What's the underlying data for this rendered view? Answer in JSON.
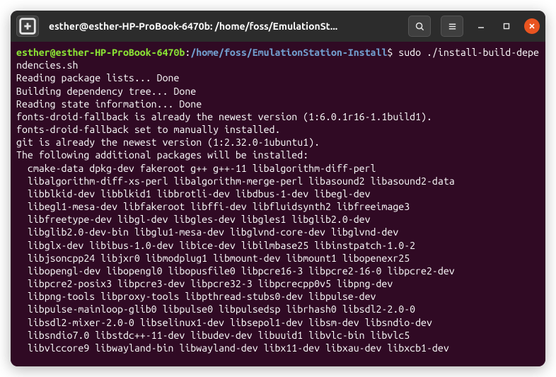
{
  "titlebar": {
    "title": "esther@esther-HP-ProBook-6470b: /home/foss/EmulationSt..."
  },
  "prompt": {
    "user": "esther@esther-HP-ProBook-6470b",
    "colon": ":",
    "path": "/home/foss/EmulationStation-Install",
    "dollar": "$",
    "command": "sudo ./install-build-dependencies.sh"
  },
  "output": {
    "l1": "Reading package lists... Done",
    "l2": "Building dependency tree... Done",
    "l3": "Reading state information... Done",
    "l4": "fonts-droid-fallback is already the newest version (1:6.0.1r16-1.1build1).",
    "l5": "fonts-droid-fallback set to manually installed.",
    "l6": "git is already the newest version (1:2.32.0-1ubuntu1).",
    "l7": "The following additional packages will be installed:",
    "p1": "  cmake-data dpkg-dev fakeroot g++ g++-11 libalgorithm-diff-perl",
    "p2": "  libalgorithm-diff-xs-perl libalgorithm-merge-perl libasound2 libasound2-data",
    "p3": "  libblkid-dev libblkid1 libbrotli-dev libdbus-1-dev libegl-dev",
    "p4": "  libegl1-mesa-dev libfakeroot libffi-dev libfluidsynth2 libfreeimage3",
    "p5": "  libfreetype-dev libgl-dev libgles-dev libgles1 libglib2.0-dev",
    "p6": "  libglib2.0-dev-bin libglu1-mesa-dev libglvnd-core-dev libglvnd-dev",
    "p7": "  libglx-dev libibus-1.0-dev libice-dev libilmbase25 libinstpatch-1.0-2",
    "p8": "  libjsoncpp24 libjxr0 libmodplug1 libmount-dev libmount1 libopenexr25",
    "p9": "  libopengl-dev libopengl0 libopusfile0 libpcre16-3 libpcre2-16-0 libpcre2-dev",
    "p10": "  libpcre2-posix3 libpcre3-dev libpcre32-3 libpcrecpp0v5 libpng-dev",
    "p11": "  libpng-tools libproxy-tools libpthread-stubs0-dev libpulse-dev",
    "p12": "  libpulse-mainloop-glib0 libpulse0 libpulsedsp librhash0 libsdl2-2.0-0",
    "p13": "  libsdl2-mixer-2.0-0 libselinux1-dev libsepol1-dev libsm-dev libsndio-dev",
    "p14": "  libsndio7.0 libstdc++-11-dev libudev-dev libuuid1 libvlc-bin libvlc5",
    "p15": "  libvlccore9 libwayland-bin libwayland-dev libx11-dev libxau-dev libxcb1-dev"
  }
}
